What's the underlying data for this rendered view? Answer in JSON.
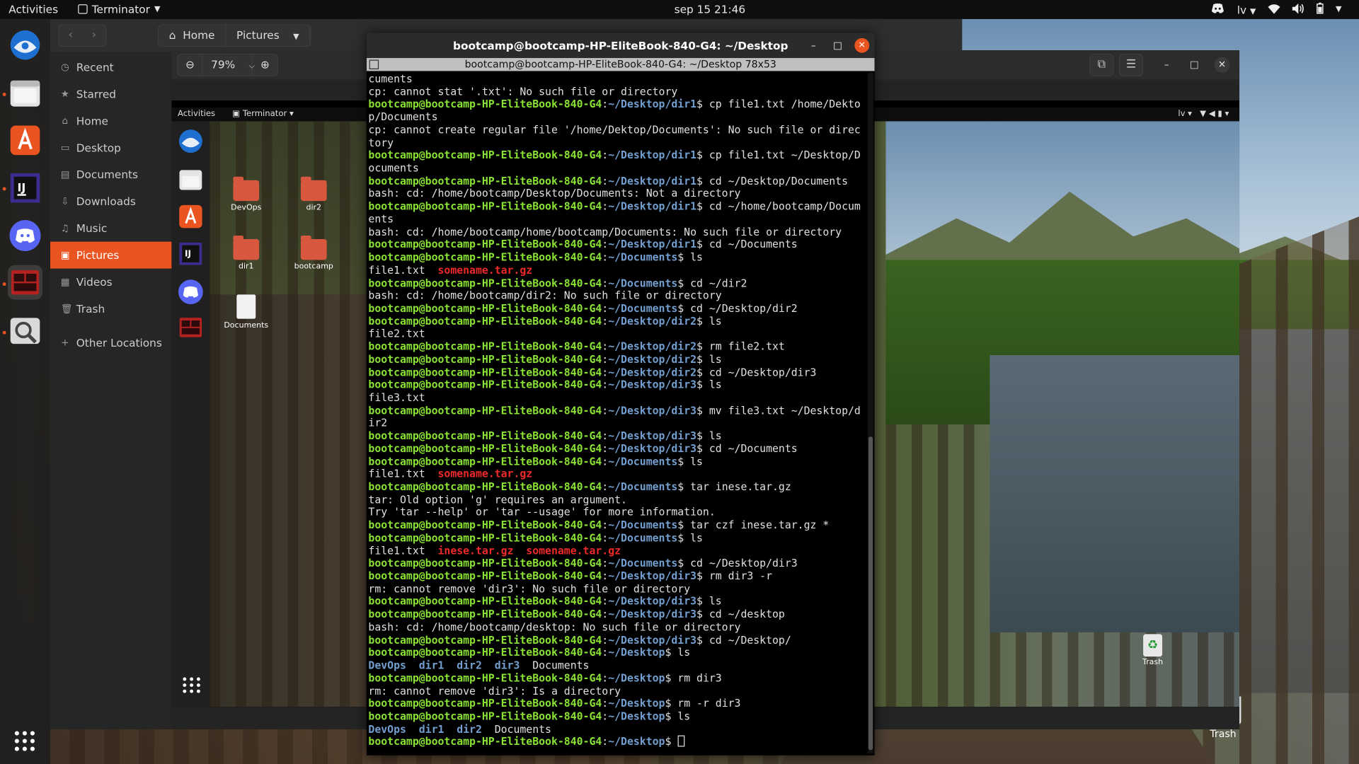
{
  "topbar": {
    "activities": "Activities",
    "app_name": "Terminator",
    "clock": "sep 15 21:46",
    "keyboard": "lv"
  },
  "files": {
    "path": [
      "Home",
      "Pictures"
    ],
    "sidebar": [
      {
        "label": "Recent",
        "icon": "clock-icon"
      },
      {
        "label": "Starred",
        "icon": "star-icon"
      },
      {
        "label": "Home",
        "icon": "home-icon"
      },
      {
        "label": "Desktop",
        "icon": "desktop-icon"
      },
      {
        "label": "Documents",
        "icon": "document-icon"
      },
      {
        "label": "Downloads",
        "icon": "download-icon"
      },
      {
        "label": "Music",
        "icon": "music-icon"
      },
      {
        "label": "Pictures",
        "icon": "picture-icon",
        "active": true
      },
      {
        "label": "Videos",
        "icon": "video-icon"
      },
      {
        "label": "Trash",
        "icon": "trash-icon"
      },
      {
        "label": "Other Locations",
        "icon": "plus-icon"
      }
    ]
  },
  "viewer": {
    "zoom": "79%"
  },
  "inner": {
    "activities": "Activities",
    "app_name": "Terminator",
    "keyboard": "lv",
    "desktop_icons": [
      "DevOps",
      "dir2",
      "dir1",
      "bootcamp",
      "Documents"
    ],
    "trash": "Trash"
  },
  "desktop": {
    "trash": "Trash"
  },
  "terminal": {
    "title": "bootcamp@bootcamp-HP-EliteBook-840-G4: ~/Desktop",
    "subtitle": "bootcamp@bootcamp-HP-EliteBook-840-G4: ~/Desktop 78x53",
    "user": "bootcamp@bootcamp-HP-EliteBook-840-G4",
    "lines": [
      {
        "t": "out",
        "text": "cuments"
      },
      {
        "t": "out",
        "text": "cp: cannot stat '.txt': No such file or directory"
      },
      {
        "t": "cmd",
        "path": "~/Desktop/dir1",
        "cmd": "cp file1.txt /home/Dekto"
      },
      {
        "t": "out",
        "text": "p/Documents"
      },
      {
        "t": "out",
        "text": "cp: cannot create regular file '/home/Dektop/Documents': No such file or direc"
      },
      {
        "t": "out",
        "text": "tory"
      },
      {
        "t": "cmd",
        "path": "~/Desktop/dir1",
        "cmd": "cp file1.txt ~/Desktop/D"
      },
      {
        "t": "out",
        "text": "ocuments"
      },
      {
        "t": "cmd",
        "path": "~/Desktop/dir1",
        "cmd": "cd ~/Desktop/Documents"
      },
      {
        "t": "out",
        "text": "bash: cd: /home/bootcamp/Desktop/Documents: Not a directory"
      },
      {
        "t": "cmd",
        "path": "~/Desktop/dir1",
        "cmd": "cd ~/home/bootcamp/Docum"
      },
      {
        "t": "out",
        "text": "ents"
      },
      {
        "t": "out",
        "text": "bash: cd: /home/bootcamp/home/bootcamp/Documents: No such file or directory"
      },
      {
        "t": "cmd",
        "path": "~/Desktop/dir1",
        "cmd": "cd ~/Documents"
      },
      {
        "t": "cmd",
        "path": "~/Documents",
        "cmd": "ls"
      },
      {
        "t": "ls",
        "items": [
          {
            "n": "file1.txt",
            "c": ""
          },
          {
            "n": "somename.tar.gz",
            "c": "rd"
          }
        ]
      },
      {
        "t": "cmd",
        "path": "~/Documents",
        "cmd": "cd ~/dir2"
      },
      {
        "t": "out",
        "text": "bash: cd: /home/bootcamp/dir2: No such file or directory"
      },
      {
        "t": "cmd",
        "path": "~/Documents",
        "cmd": "cd ~/Desktop/dir2"
      },
      {
        "t": "cmd",
        "path": "~/Desktop/dir2",
        "cmd": "ls"
      },
      {
        "t": "out",
        "text": "file2.txt"
      },
      {
        "t": "cmd",
        "path": "~/Desktop/dir2",
        "cmd": "rm file2.txt"
      },
      {
        "t": "cmd",
        "path": "~/Desktop/dir2",
        "cmd": "ls"
      },
      {
        "t": "cmd",
        "path": "~/Desktop/dir2",
        "cmd": "cd ~/Desktop/dir3"
      },
      {
        "t": "cmd",
        "path": "~/Desktop/dir3",
        "cmd": "ls"
      },
      {
        "t": "out",
        "text": "file3.txt"
      },
      {
        "t": "cmd",
        "path": "~/Desktop/dir3",
        "cmd": "mv file3.txt ~/Desktop/d"
      },
      {
        "t": "out",
        "text": "ir2"
      },
      {
        "t": "cmd",
        "path": "~/Desktop/dir3",
        "cmd": "ls"
      },
      {
        "t": "cmd",
        "path": "~/Desktop/dir3",
        "cmd": "cd ~/Documents"
      },
      {
        "t": "cmd",
        "path": "~/Documents",
        "cmd": "ls"
      },
      {
        "t": "ls",
        "items": [
          {
            "n": "file1.txt",
            "c": ""
          },
          {
            "n": "somename.tar.gz",
            "c": "rd"
          }
        ]
      },
      {
        "t": "cmd",
        "path": "~/Documents",
        "cmd": "tar inese.tar.gz"
      },
      {
        "t": "out",
        "text": "tar: Old option 'g' requires an argument."
      },
      {
        "t": "out",
        "text": "Try 'tar --help' or 'tar --usage' for more information."
      },
      {
        "t": "cmd",
        "path": "~/Documents",
        "cmd": "tar czf inese.tar.gz *"
      },
      {
        "t": "cmd",
        "path": "~/Documents",
        "cmd": "ls"
      },
      {
        "t": "ls",
        "items": [
          {
            "n": "file1.txt",
            "c": ""
          },
          {
            "n": "inese.tar.gz",
            "c": "rd"
          },
          {
            "n": "somename.tar.gz",
            "c": "rd"
          }
        ]
      },
      {
        "t": "cmd",
        "path": "~/Documents",
        "cmd": "cd ~/Desktop/dir3"
      },
      {
        "t": "cmd",
        "path": "~/Desktop/dir3",
        "cmd": "rm dir3 -r"
      },
      {
        "t": "out",
        "text": "rm: cannot remove 'dir3': No such file or directory"
      },
      {
        "t": "cmd",
        "path": "~/Desktop/dir3",
        "cmd": "ls"
      },
      {
        "t": "cmd",
        "path": "~/Desktop/dir3",
        "cmd": "cd ~/desktop"
      },
      {
        "t": "out",
        "text": "bash: cd: /home/bootcamp/desktop: No such file or directory"
      },
      {
        "t": "cmd",
        "path": "~/Desktop/dir3",
        "cmd": "cd ~/Desktop/"
      },
      {
        "t": "cmd",
        "path": "~/Desktop",
        "cmd": "ls"
      },
      {
        "t": "ls",
        "items": [
          {
            "n": "DevOps",
            "c": "bl"
          },
          {
            "n": "dir1",
            "c": "bl"
          },
          {
            "n": "dir2",
            "c": "bl"
          },
          {
            "n": "dir3",
            "c": "bl"
          },
          {
            "n": "Documents",
            "c": ""
          }
        ]
      },
      {
        "t": "cmd",
        "path": "~/Desktop",
        "cmd": "rm dir3"
      },
      {
        "t": "out",
        "text": "rm: cannot remove 'dir3': Is a directory"
      },
      {
        "t": "cmd",
        "path": "~/Desktop",
        "cmd": "rm -r dir3"
      },
      {
        "t": "cmd",
        "path": "~/Desktop",
        "cmd": "ls"
      },
      {
        "t": "ls",
        "items": [
          {
            "n": "DevOps",
            "c": "bl"
          },
          {
            "n": "dir1",
            "c": "bl"
          },
          {
            "n": "dir2",
            "c": "bl"
          },
          {
            "n": "Documents",
            "c": ""
          }
        ]
      },
      {
        "t": "prompt",
        "path": "~/Desktop",
        "cmd": ""
      }
    ]
  },
  "colors": {
    "accent": "#e95420",
    "prompt_user": "#8ae234",
    "prompt_path": "#729fcf",
    "archive": "#ef2929",
    "directory": "#729fcf"
  }
}
